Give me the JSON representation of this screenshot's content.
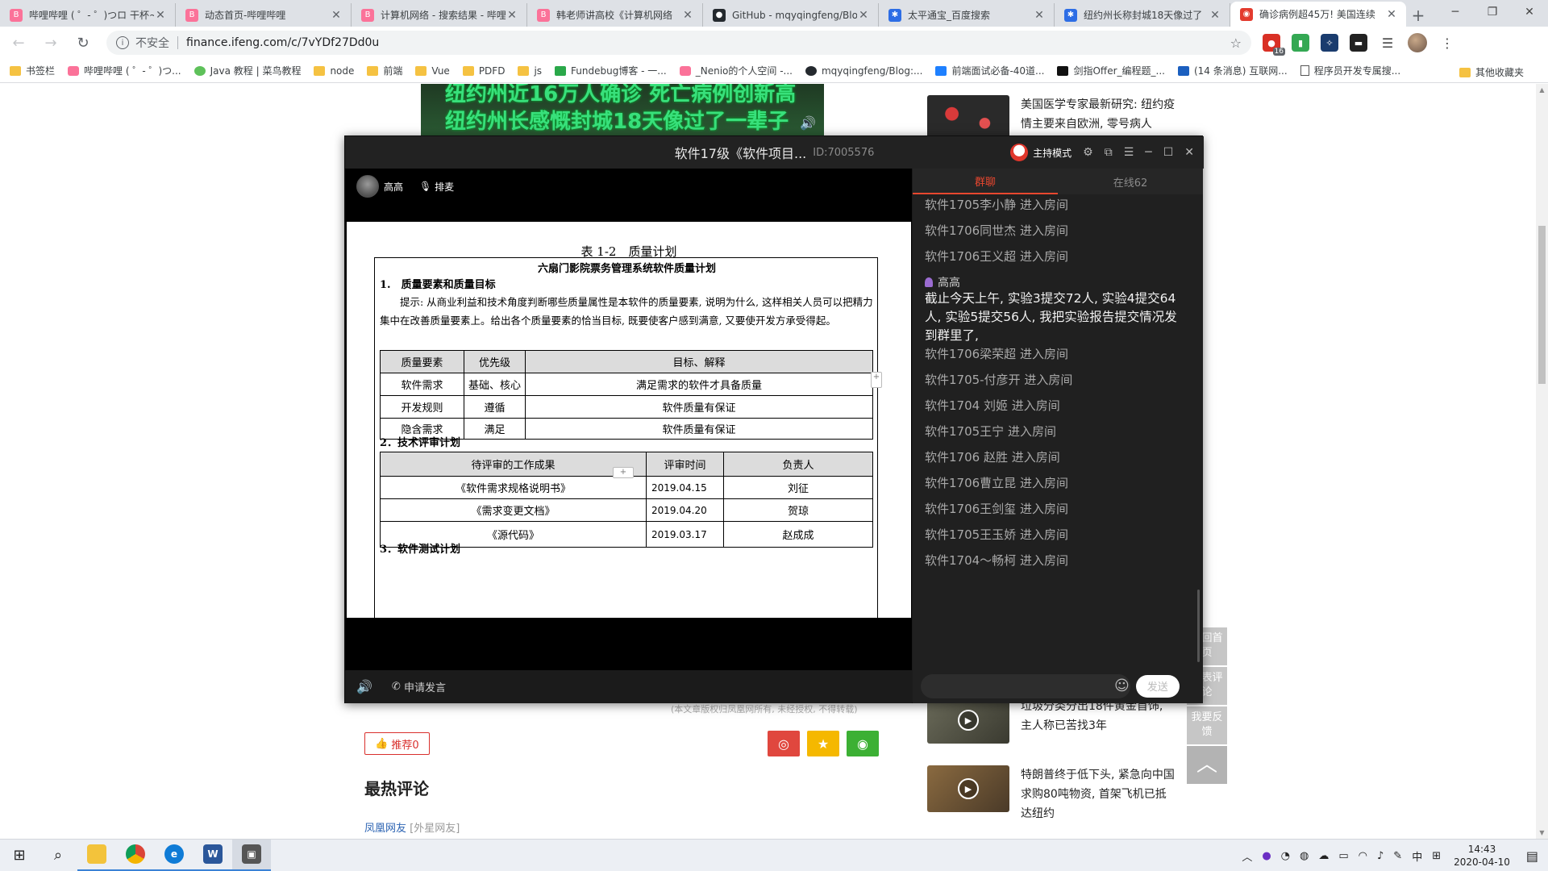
{
  "browser": {
    "tabs": [
      {
        "title": "哔哩哔哩 ( ゜- ゜)つロ 干杯~-bilibili",
        "favicon": "bilibili-icon",
        "active": false
      },
      {
        "title": "动态首页-哔哩哔哩",
        "favicon": "bilibili-icon",
        "active": false
      },
      {
        "title": "计算机网络 - 搜索结果 - 哔哩哔哩",
        "favicon": "bilibili-icon",
        "active": false
      },
      {
        "title": "韩老师讲高校《计算机网络",
        "favicon": "bilibili-icon",
        "active": false
      },
      {
        "title": "GitHub - mqyqingfeng/Blog",
        "favicon": "github-icon",
        "active": false
      },
      {
        "title": "太平通宝_百度搜索",
        "favicon": "baidu-icon",
        "active": false
      },
      {
        "title": "纽约州长称封城18天像过了",
        "favicon": "baidu-icon",
        "active": false
      },
      {
        "title": "确诊病例超45万! 美国连续",
        "favicon": "ifeng-icon",
        "active": true
      }
    ],
    "new_tab": "+",
    "address": {
      "security_label": "不安全",
      "url": "finance.ifeng.com/c/7vYDf27Dd0u"
    },
    "extension_badge": "16",
    "bookmarks": [
      {
        "label": "书签栏",
        "icon": "folder-icon"
      },
      {
        "label": "哔哩哔哩 ( ゜- ゜)つ...",
        "icon": "bilibili-icon"
      },
      {
        "label": "Java 教程 | 菜鸟教程",
        "icon": "runoob-icon"
      },
      {
        "label": "node",
        "icon": "folder-icon"
      },
      {
        "label": "前端",
        "icon": "folder-icon"
      },
      {
        "label": "Vue",
        "icon": "folder-icon"
      },
      {
        "label": "PDFD",
        "icon": "folder-icon"
      },
      {
        "label": "js",
        "icon": "folder-icon"
      },
      {
        "label": "Fundebug博客 - 一...",
        "icon": "fundebug-icon"
      },
      {
        "label": "_Nenio的个人空间 -...",
        "icon": "bilibili-icon"
      },
      {
        "label": "mqyqingfeng/Blog:...",
        "icon": "github-icon"
      },
      {
        "label": "前端面试必备-40道...",
        "icon": "juejin-icon"
      },
      {
        "label": "剑指Offer_编程题_...",
        "icon": "nowcoder-icon"
      },
      {
        "label": "(14 条消息) 互联网...",
        "icon": "csdn-icon"
      },
      {
        "label": "程序员开发专属搜...",
        "icon": "page-icon"
      }
    ],
    "other_bookmarks": "其他收藏夹"
  },
  "article": {
    "video_caption_line1": "纽约州近16万人确诊 死亡病例创新高",
    "video_caption_line2": "纽约州长感慨封城18天像过了一辈子",
    "side_news": [
      {
        "title": "美国医学专家最新研究: 纽约疫情主要来自欧洲, 零号病人"
      },
      {
        "title": "垃圾分类分出18件黄金首饰, 主人称已苦找3年"
      },
      {
        "title": "特朗普终于低下头, 紧急向中国求购80吨物资, 首架飞机已抵达纽约"
      }
    ],
    "copyright": "(本文章版权归凤凰网所有, 未经授权, 不得转载)",
    "recommend": "推荐0",
    "hot_comments_title": "最热评论",
    "comment_user": "凤凰网友",
    "comment_location": "[外星网友]",
    "float_buttons": [
      "返回首页",
      "发表评论",
      "我要反馈"
    ]
  },
  "live": {
    "title": "软件17级《软件项目...",
    "room_id": "ID:7005576",
    "host_mode": "主持模式",
    "teacher_name": "高高",
    "hand_label": "排麦",
    "apply_speak": "申请发言",
    "doc": {
      "caption": "表 1-2　质量计划",
      "heading": "六扇门影院票务管理系统软件质量计划",
      "section1": "1.　质量要素和质量目标",
      "hint": "提示: 从商业利益和技术角度判断哪些质量属性是本软件的质量要素, 说明为什么, 这样相关人员可以把精力集中在改善质量要素上。给出各个质量要素的恰当目标, 既要使客户感到满意, 又要使开发方承受得起。",
      "table1_headers": [
        "质量要素",
        "优先级",
        "目标、解释"
      ],
      "table1_rows": [
        [
          "软件需求",
          "基础、核心",
          "满足需求的软件才具备质量"
        ],
        [
          "开发规则",
          "遵循",
          "软件质量有保证"
        ],
        [
          "隐含需求",
          "满足",
          "软件质量有保证"
        ]
      ],
      "section2": "2．技术评审计划",
      "table2_headers": [
        "待评审的工作成果",
        "评审时间",
        "负责人"
      ],
      "table2_rows": [
        [
          "《软件需求规格说明书》",
          "2019.04.15",
          "刘征"
        ],
        [
          "《需求变更文档》",
          "2019.04.20",
          "贺琼"
        ],
        [
          "《源代码》",
          "2019.03.17",
          "赵成成"
        ]
      ],
      "section3": "3．软件测试计划"
    },
    "chat": {
      "tab_group": "群聊",
      "tab_online": "在线62",
      "joins_before": [
        "软件1705李小静 进入房间",
        "软件1706同世杰 进入房间",
        "软件1706王义超 进入房间"
      ],
      "message_sender": "高高",
      "message_text": "截止今天上午, 实验3提交72人, 实验4提交64人, 实验5提交56人, 我把实验报告提交情况发到群里了,",
      "joins_after": [
        "软件1706梁荣超 进入房间",
        "软件1705-付彦开 进入房间",
        "软件1704 刘姬 进入房间",
        "软件1705王宁 进入房间",
        "软件1706 赵胜 进入房间",
        "软件1706曹立昆 进入房间",
        "软件1706王剑玺 进入房间",
        "软件1705王玉娇 进入房间",
        "软件1704～畅柯 进入房间"
      ],
      "send_label": "发送"
    }
  },
  "taskbar": {
    "apps": [
      "windows-start-icon",
      "search-icon",
      "file-explorer-icon",
      "chrome-icon",
      "edge-icon",
      "word-icon",
      "classroom-app-icon"
    ],
    "ime": "中",
    "time": "14:43",
    "date": "2020-04-10"
  },
  "colors": {
    "accent_red": "#e8472f",
    "weibo": "#e0473e",
    "favorite": "#f5b800",
    "wechat": "#3cb034"
  }
}
